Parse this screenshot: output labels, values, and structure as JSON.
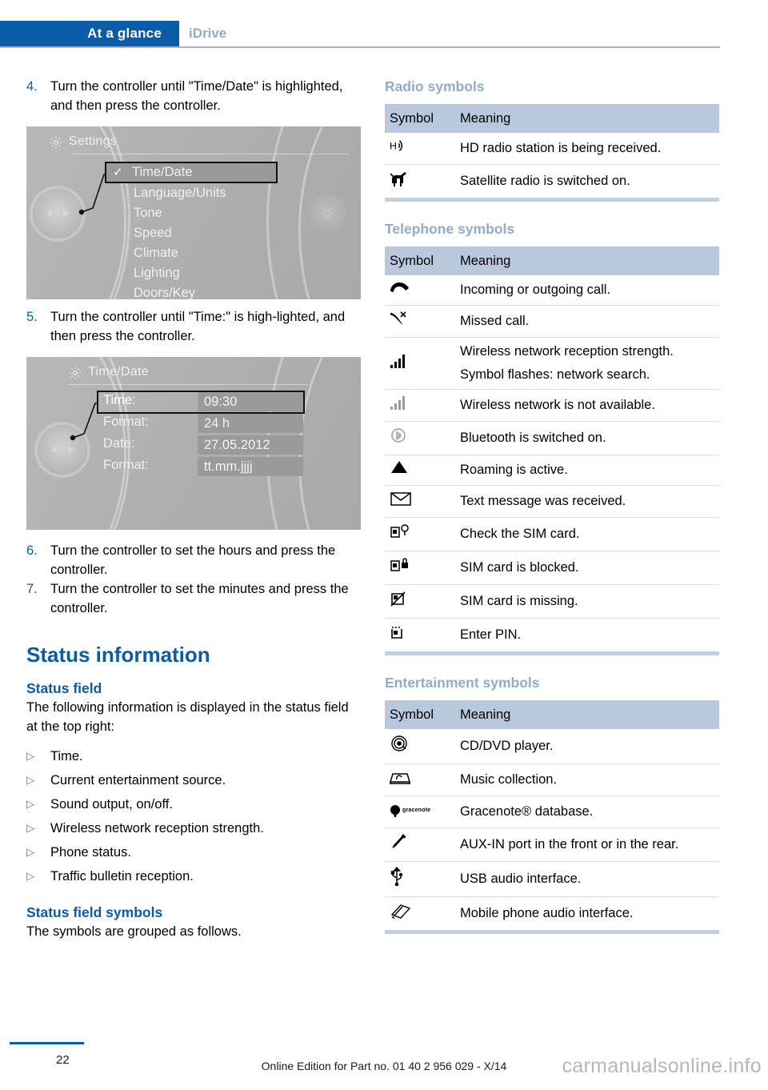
{
  "header": {
    "active_tab": "At a glance",
    "inactive_tab": "iDrive"
  },
  "left_column": {
    "steps": [
      {
        "num": "4.",
        "text": "Turn the controller until \"Time/Date\" is highlighted, and then press the controller."
      },
      {
        "num": "5.",
        "text": "Turn the controller until \"Time:\" is high-lighted, and then press the controller."
      },
      {
        "num": "6.",
        "text": "Turn the controller to set the hours and press the controller."
      },
      {
        "num": "7.",
        "text": "Turn the controller to set the minutes and press the controller."
      }
    ],
    "figure_settings": {
      "title": "Settings",
      "gear_icon": "gear-icon",
      "items": [
        {
          "label": "Time/Date",
          "selected": true,
          "checked": true
        },
        {
          "label": "Language/Units",
          "selected": false,
          "checked": false
        },
        {
          "label": "Tone",
          "selected": false,
          "checked": false
        },
        {
          "label": "Speed",
          "selected": false,
          "checked": false
        },
        {
          "label": "Climate",
          "selected": false,
          "checked": false
        },
        {
          "label": "Lighting",
          "selected": false,
          "checked": false
        },
        {
          "label": "Doors/Key",
          "selected": false,
          "checked": false
        }
      ]
    },
    "figure_timedate": {
      "title": "Time/Date",
      "gear_icon": "gear-icon",
      "rows": [
        {
          "label": "Time:",
          "value": "09:30",
          "selected": true
        },
        {
          "label": "Format:",
          "value": "24 h",
          "selected": false
        },
        {
          "label": "Date:",
          "value": "27.05.2012",
          "selected": false
        },
        {
          "label": "Format:",
          "value": "tt.mm.jjjj",
          "selected": false
        }
      ]
    },
    "section_title": "Status information",
    "status_field_heading": "Status field",
    "status_field_intro": "The following information is displayed in the status field at the top right:",
    "status_field_bullets": [
      "Time.",
      "Current entertainment source.",
      "Sound output, on/off.",
      "Wireless network reception strength.",
      "Phone status.",
      "Traffic bulletin reception."
    ],
    "status_symbols_heading": "Status field symbols",
    "status_symbols_intro": "The symbols are grouped as follows."
  },
  "right_column": {
    "radio": {
      "heading": "Radio symbols",
      "columns": [
        "Symbol",
        "Meaning"
      ],
      "rows": [
        {
          "icon": "hd-radio-icon",
          "glyph": "HD",
          "meaning": "HD radio station is being received."
        },
        {
          "icon": "satellite-radio-icon",
          "glyph": "SAT",
          "meaning": "Satellite radio is switched on."
        }
      ]
    },
    "telephone": {
      "heading": "Telephone symbols",
      "columns": [
        "Symbol",
        "Meaning"
      ],
      "rows": [
        {
          "icon": "phone-handset-icon",
          "meaning": "Incoming or outgoing call."
        },
        {
          "icon": "missed-call-icon",
          "meaning": "Missed call."
        },
        {
          "icon": "signal-bars-full-icon",
          "meaning": "Wireless network reception strength.",
          "note": "Symbol flashes: network search."
        },
        {
          "icon": "signal-bars-gray-icon",
          "meaning": "Wireless network is not available."
        },
        {
          "icon": "bluetooth-icon",
          "meaning": "Bluetooth is switched on."
        },
        {
          "icon": "roaming-triangle-icon",
          "meaning": "Roaming is active."
        },
        {
          "icon": "envelope-icon",
          "meaning": "Text message was received."
        },
        {
          "icon": "sim-check-icon",
          "meaning": "Check the SIM card."
        },
        {
          "icon": "sim-blocked-icon",
          "meaning": "SIM card is blocked."
        },
        {
          "icon": "sim-missing-icon",
          "meaning": "SIM card is missing."
        },
        {
          "icon": "sim-pin-icon",
          "meaning": "Enter PIN."
        }
      ]
    },
    "entertainment": {
      "heading": "Entertainment symbols",
      "columns": [
        "Symbol",
        "Meaning"
      ],
      "rows": [
        {
          "icon": "cd-dvd-icon",
          "meaning": "CD/DVD player."
        },
        {
          "icon": "music-collection-icon",
          "meaning": "Music collection."
        },
        {
          "icon": "gracenote-icon",
          "glyph": "gracenote",
          "meaning": "Gracenote® database."
        },
        {
          "icon": "aux-in-icon",
          "meaning": "AUX-IN port in the front or in the rear."
        },
        {
          "icon": "usb-icon",
          "meaning": "USB audio interface."
        },
        {
          "icon": "mobile-audio-icon",
          "meaning": "Mobile phone audio interface."
        }
      ]
    }
  },
  "footer": {
    "page_number": "22",
    "edition_text": "Online Edition for Part no. 01 40 2 956 029 - X/14",
    "watermark": "carmanualsonline.info"
  }
}
